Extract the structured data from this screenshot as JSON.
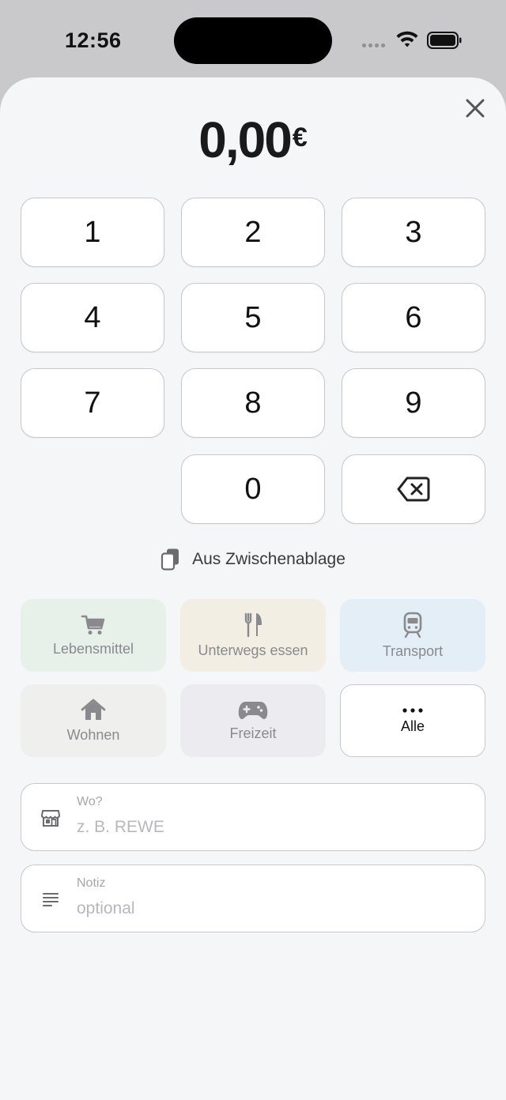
{
  "status_bar": {
    "time": "12:56"
  },
  "amount": {
    "value": "0,00",
    "currency": "€"
  },
  "keypad": {
    "keys": [
      "1",
      "2",
      "3",
      "4",
      "5",
      "6",
      "7",
      "8",
      "9",
      "0"
    ]
  },
  "clipboard": {
    "label": "Aus Zwischenablage"
  },
  "categories": [
    {
      "label": "Lebensmittel",
      "icon": "cart-icon",
      "color": "#e8f0ea"
    },
    {
      "label": "Unterwegs essen",
      "icon": "fork-knife-icon",
      "color": "#f2eee3"
    },
    {
      "label": "Transport",
      "icon": "tram-icon",
      "color": "#e3eef6"
    },
    {
      "label": "Wohnen",
      "icon": "house-icon",
      "color": "#efefed"
    },
    {
      "label": "Freizeit",
      "icon": "gamecontroller-icon",
      "color": "#ececf0"
    },
    {
      "label": "Alle",
      "icon": "more-icon",
      "color": "#ffffff"
    }
  ],
  "fields": {
    "where": {
      "label": "Wo?",
      "placeholder": "z. B. REWE"
    },
    "note": {
      "label": "Notiz",
      "placeholder": "optional"
    }
  }
}
